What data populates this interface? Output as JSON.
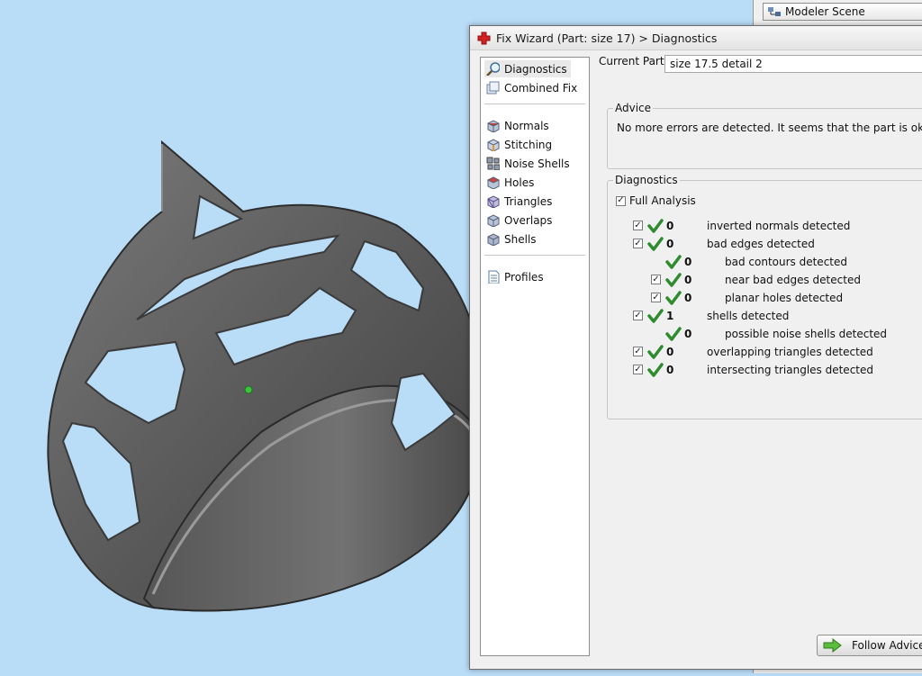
{
  "modeler": {
    "scene_tab_label": "Modeler Scene"
  },
  "wizard": {
    "title": "Fix Wizard (Part: size 17) > Diagnostics",
    "nav": {
      "top_items": [
        {
          "label": "Diagnostics",
          "icon": "magnifier-icon"
        },
        {
          "label": "Combined Fix",
          "icon": "combined-fix-icon"
        }
      ],
      "tool_items": [
        {
          "label": "Normals",
          "icon": "normals-cube-icon"
        },
        {
          "label": "Stitching",
          "icon": "stitching-cube-icon"
        },
        {
          "label": "Noise Shells",
          "icon": "noise-shells-icon"
        },
        {
          "label": "Holes",
          "icon": "holes-cube-icon"
        },
        {
          "label": "Triangles",
          "icon": "triangles-cube-icon"
        },
        {
          "label": "Overlaps",
          "icon": "overlaps-cube-icon"
        },
        {
          "label": "Shells",
          "icon": "shells-cube-icon"
        }
      ],
      "bottom_items": [
        {
          "label": "Profiles",
          "icon": "profiles-document-icon"
        }
      ]
    },
    "current_part_label": "Current Part:",
    "current_part_value": "size 17.5 detail 2",
    "advice": {
      "title": "Advice",
      "text": "No more errors are detected. It seems that the part is ok."
    },
    "diagnostics": {
      "title": "Diagnostics",
      "full_analysis_label": "Full Analysis",
      "rows": [
        {
          "count": "0",
          "label": "inverted normals detected",
          "checkbox": true,
          "level": 0
        },
        {
          "count": "0",
          "label": "bad edges detected",
          "checkbox": true,
          "level": 0
        },
        {
          "count": "0",
          "label": "bad contours detected",
          "checkbox": false,
          "level": 1
        },
        {
          "count": "0",
          "label": "near bad edges detected",
          "checkbox": true,
          "level": 1
        },
        {
          "count": "0",
          "label": "planar holes detected",
          "checkbox": true,
          "level": 1
        },
        {
          "count": "1",
          "label": "shells detected",
          "checkbox": true,
          "level": 0
        },
        {
          "count": "0",
          "label": "possible noise shells detected",
          "checkbox": false,
          "level": 1
        },
        {
          "count": "0",
          "label": "overlapping triangles detected",
          "checkbox": true,
          "level": 0
        },
        {
          "count": "0",
          "label": "intersecting triangles detected",
          "checkbox": true,
          "level": 0
        }
      ]
    },
    "follow_advice_label": "Follow Advice"
  },
  "colors": {
    "viewport_background": "#b9dcf7",
    "ok_tick": "#2e8b2e",
    "wizard_icon_red": "#d42020"
  }
}
